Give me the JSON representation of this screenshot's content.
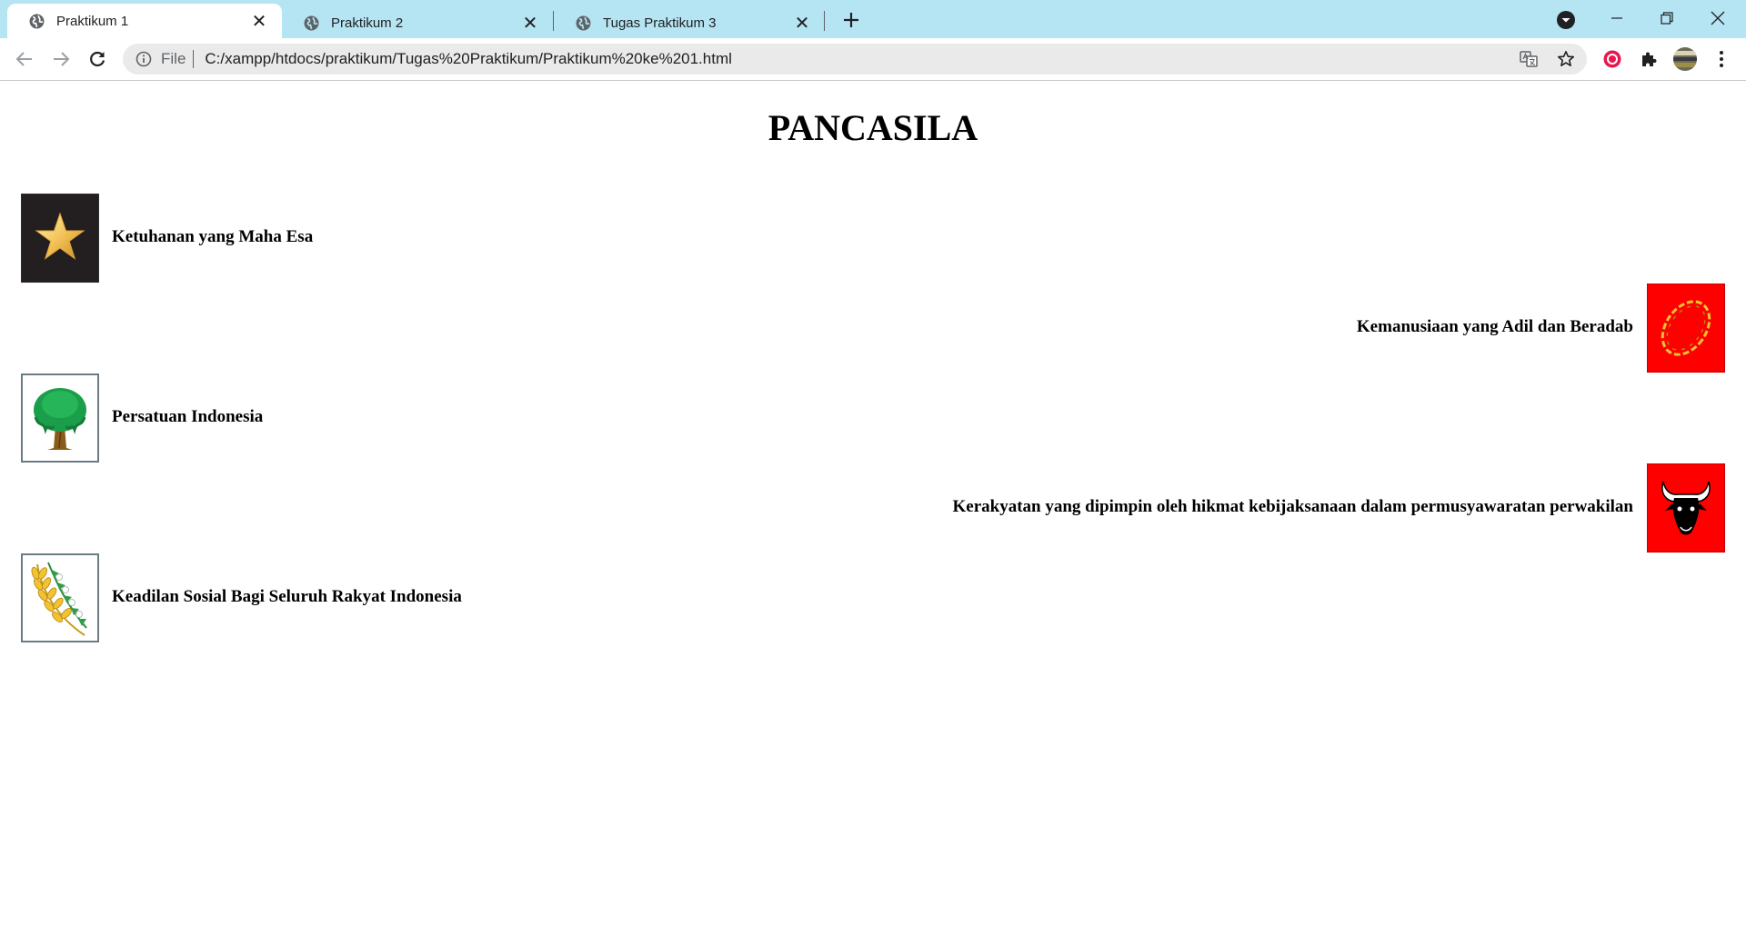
{
  "browser": {
    "tabs": [
      {
        "title": "Praktikum 1",
        "active": true
      },
      {
        "title": "Praktikum 2",
        "active": false
      },
      {
        "title": "Tugas Praktikum 3",
        "active": false
      }
    ],
    "address": {
      "scheme_label": "File",
      "url": "C:/xampp/htdocs/praktikum/Tugas%20Praktikum/Praktikum%20ke%201.html"
    },
    "icons": {
      "tab": "globe-icon",
      "close": "close-icon",
      "new_tab": "plus-icon",
      "tab_search": "chevron-down-icon",
      "back": "back-arrow-icon",
      "forward": "forward-arrow-icon",
      "reload": "reload-icon",
      "site_info": "info-icon",
      "translate": "translate-icon",
      "bookmark": "star-icon",
      "extensions": "puzzle-icon",
      "menu": "kebab-menu-icon"
    },
    "colors": {
      "tabstrip": "#b5e4f2",
      "omnibox": "#eaeaea"
    }
  },
  "page": {
    "title": "PANCASILA",
    "sila": [
      {
        "text": "Ketuhanan yang Maha Esa",
        "side": "left",
        "emblem": "star-emblem",
        "bg": "#231f20"
      },
      {
        "text": "Kemanusiaan yang Adil dan Beradab",
        "side": "right",
        "emblem": "chain-emblem",
        "bg": "#ff0000"
      },
      {
        "text": "Persatuan Indonesia",
        "side": "left",
        "emblem": "banyan-tree-emblem",
        "bg": "#ffffff"
      },
      {
        "text": "Kerakyatan yang dipimpin oleh hikmat kebijaksanaan dalam permusyawaratan perwakilan",
        "side": "right",
        "emblem": "bull-head-emblem",
        "bg": "#ff0000"
      },
      {
        "text": "Keadilan Sosial Bagi Seluruh Rakyat Indonesia",
        "side": "left",
        "emblem": "rice-cotton-emblem",
        "bg": "#ffffff"
      }
    ]
  }
}
